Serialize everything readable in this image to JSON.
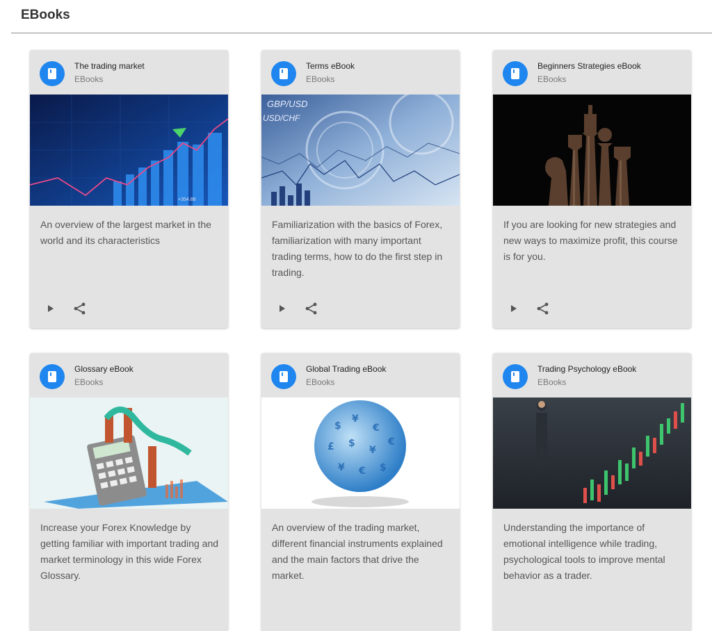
{
  "page": {
    "title": "EBooks"
  },
  "cards": [
    {
      "title": "The trading market",
      "category": "EBooks",
      "description": "An overview of the largest market in the world and its characteristics",
      "image_label": "+354.88",
      "icon": "book-icon"
    },
    {
      "title": "Terms eBook",
      "category": "EBooks",
      "description": "Familiarization with the basics of Forex, familiarization with many important trading terms, how to do the first step in trading.",
      "image_label": "GBP/USD",
      "image_label_2": "USD/CHF",
      "icon": "book-icon"
    },
    {
      "title": "Beginners Strategies eBook",
      "category": "EBooks",
      "description": "If you are looking for new strategies and new ways to maximize profit, this course is for you.",
      "icon": "book-icon"
    },
    {
      "title": "Glossary eBook",
      "category": "EBooks",
      "description": "Increase your Forex Knowledge by getting familiar with important trading and market terminology in this wide Forex Glossary.",
      "icon": "book-icon"
    },
    {
      "title": "Global Trading eBook",
      "category": "EBooks",
      "description": "An overview of the trading market, different financial instruments explained and the main factors that drive the market.",
      "icon": "book-icon"
    },
    {
      "title": "Trading Psychology eBook",
      "category": "EBooks",
      "description": "Understanding the importance of emotional intelligence while trading, psychological tools to improve mental behavior as a trader.",
      "icon": "book-icon"
    }
  ],
  "colors": {
    "accent": "#1e86ee",
    "card_bg": "#e3e3e3",
    "icon_gray": "#555555"
  }
}
